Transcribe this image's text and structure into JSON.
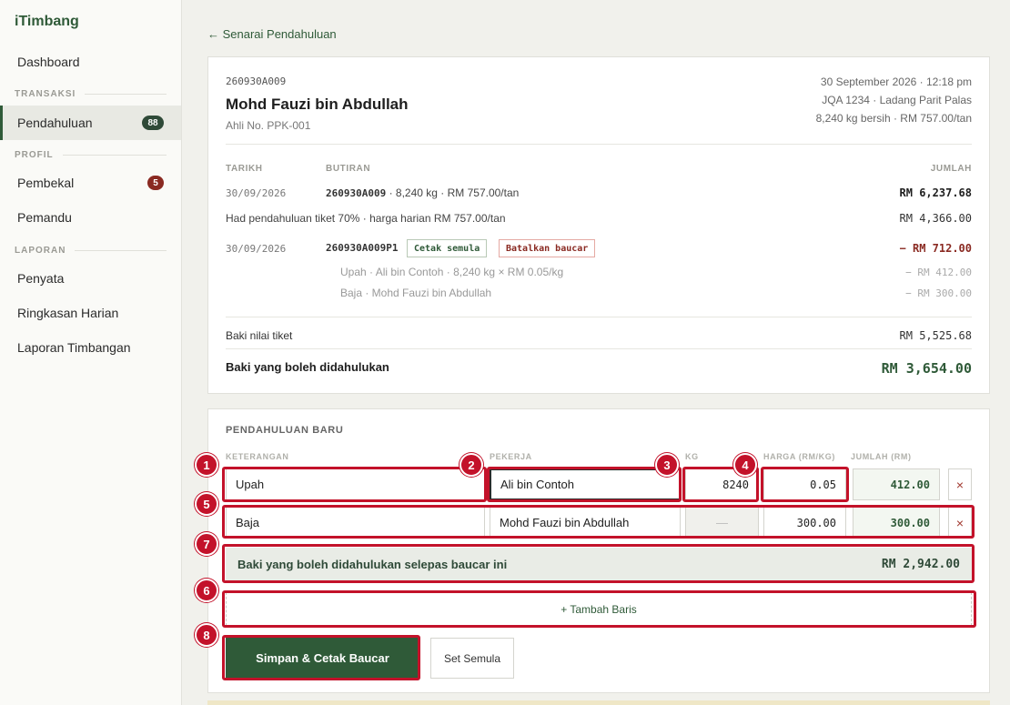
{
  "app": {
    "name": "iTimbang"
  },
  "sidebar": {
    "dashboard": "Dashboard",
    "section_transaksi": "TRANSAKSI",
    "pendahuluan": {
      "label": "Pendahuluan",
      "count": "88"
    },
    "section_profil": "PROFIL",
    "pembekal": {
      "label": "Pembekal",
      "count": "5"
    },
    "pemandu": "Pemandu",
    "section_laporan": "LAPORAN",
    "penyata": "Penyata",
    "ringkasan": "Ringkasan Harian",
    "laporan_timbangan": "Laporan Timbangan"
  },
  "back_link": "← Senarai Pendahuluan",
  "ticket": {
    "id": "260930A009",
    "farmer_name": "Mohd Fauzi bin Abdullah",
    "member": "Ahli No. PPK-001",
    "datetime": "30 September 2026 · 12:18 pm",
    "vehicle": "JQA 1234 · Ladang Parit Palas",
    "weight_price": "8,240 kg bersih · RM 757.00/tan"
  },
  "ledger": {
    "headers": {
      "date": "TARIKH",
      "details": "BUTIRAN",
      "amount": "JUMLAH"
    },
    "row1": {
      "date": "30/09/2026",
      "id": "260930A009",
      "details": " · 8,240 kg · RM 757.00/tan",
      "amount": "RM 6,237.68"
    },
    "limit": {
      "text": "Had pendahuluan tiket 70% · harga harian RM 757.00/tan",
      "amount": "RM 4,366.00"
    },
    "row2": {
      "date": "30/09/2026",
      "id": "260930A009P1",
      "reprint": "Cetak semula",
      "cancel": "Batalkan baucar",
      "amount": "− RM 712.00"
    },
    "sub1": {
      "text": "Upah · Ali bin Contoh · 8,240 kg × RM 0.05/kg",
      "amount": "− RM 412.00"
    },
    "sub2": {
      "text": "Baja · Mohd Fauzi bin Abdullah",
      "amount": "− RM 300.00"
    },
    "balance": {
      "label": "Baki nilai tiket",
      "amount": "RM 5,525.68"
    },
    "advanceable": {
      "label": "Baki yang boleh didahulukan",
      "amount": "RM 3,654.00"
    }
  },
  "form": {
    "title": "PENDAHULUAN BARU",
    "columns": {
      "desc": "KETERANGAN",
      "worker": "PEKERJA",
      "kg": "KG",
      "price": "HARGA (RM/KG)",
      "total": "JUMLAH (RM)"
    },
    "rows": [
      {
        "desc": "Upah",
        "worker": "Ali bin Contoh",
        "kg": "8240",
        "price": "0.05",
        "total": "412.00"
      },
      {
        "desc": "Baja",
        "worker": "Mohd Fauzi bin Abdullah",
        "kg": "—",
        "price": "300.00",
        "total": "300.00"
      }
    ],
    "remove": "×",
    "after_label": "Baki yang boleh didahulukan selepas baucar ini",
    "after_amount": "RM 2,942.00",
    "add_row": "+ Tambah Baris",
    "save": "Simpan & Cetak Baucar",
    "reset": "Set Semula"
  },
  "annotations": [
    "1",
    "2",
    "3",
    "4",
    "5",
    "6",
    "7",
    "8"
  ],
  "colors": {
    "brand": "#2f5a38",
    "danger": "#8a2a22",
    "annotation": "#c3122a"
  }
}
